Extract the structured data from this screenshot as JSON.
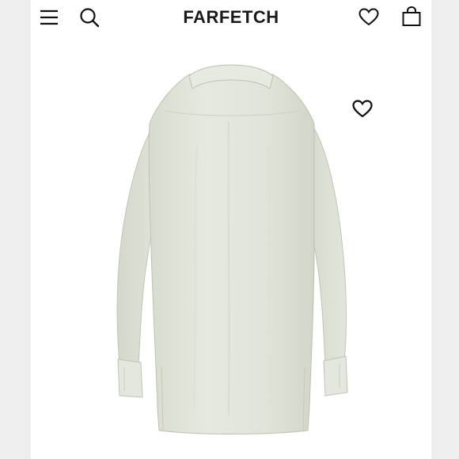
{
  "header": {
    "brand": "FARFETCH",
    "icons": [
      "menu-icon",
      "search-icon",
      "heart-icon",
      "shopping-bag-icon"
    ]
  },
  "product": {
    "image": "shirt-back-view",
    "favorite_icon": "heart-icon",
    "colors": {
      "fabric": "#e3e6dd",
      "fabric_shadow": "#cfd3c8",
      "outline": "#b9beb2"
    }
  }
}
